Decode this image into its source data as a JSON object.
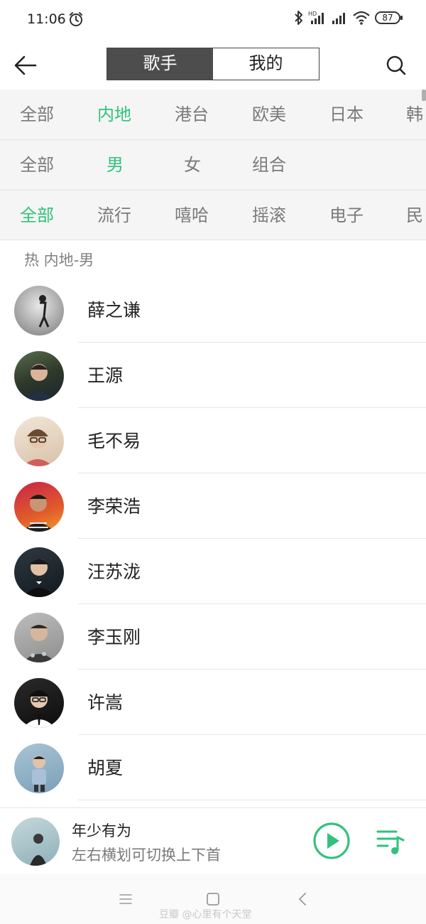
{
  "status_bar": {
    "time": "11:06",
    "battery": "87",
    "icons": [
      "alarm-icon",
      "bluetooth-icon",
      "hd-signal-icon",
      "signal-icon",
      "wifi-icon",
      "battery-icon"
    ]
  },
  "header": {
    "tabs": [
      {
        "label": "歌手",
        "active": true
      },
      {
        "label": "我的",
        "active": false
      }
    ]
  },
  "filters": {
    "regions": [
      {
        "label": "全部",
        "active": false
      },
      {
        "label": "内地",
        "active": true
      },
      {
        "label": "港台",
        "active": false
      },
      {
        "label": "欧美",
        "active": false
      },
      {
        "label": "日本",
        "active": false
      },
      {
        "label": "韩",
        "active": false
      }
    ],
    "genders": [
      {
        "label": "全部",
        "active": false
      },
      {
        "label": "男",
        "active": true
      },
      {
        "label": "女",
        "active": false
      },
      {
        "label": "组合",
        "active": false
      }
    ],
    "genres": [
      {
        "label": "全部",
        "active": true
      },
      {
        "label": "流行",
        "active": false
      },
      {
        "label": "嘻哈",
        "active": false
      },
      {
        "label": "摇滚",
        "active": false
      },
      {
        "label": "电子",
        "active": false
      },
      {
        "label": "民",
        "active": false
      }
    ]
  },
  "section": {
    "title": "热 内地-男"
  },
  "singers": [
    {
      "name": "薛之谦"
    },
    {
      "name": "王源"
    },
    {
      "name": "毛不易"
    },
    {
      "name": "李荣浩"
    },
    {
      "name": "汪苏泷"
    },
    {
      "name": "李玉刚"
    },
    {
      "name": "许嵩"
    },
    {
      "name": "胡夏"
    }
  ],
  "player": {
    "title": "年少有为",
    "subtitle": "左右横划可切换上下首"
  },
  "watermark": "豆瓣 @心里有个天堂",
  "colors": {
    "accent": "#31c27c",
    "segment_active_bg": "#4d4d4d",
    "filter_bg": "#f5f5f5"
  }
}
